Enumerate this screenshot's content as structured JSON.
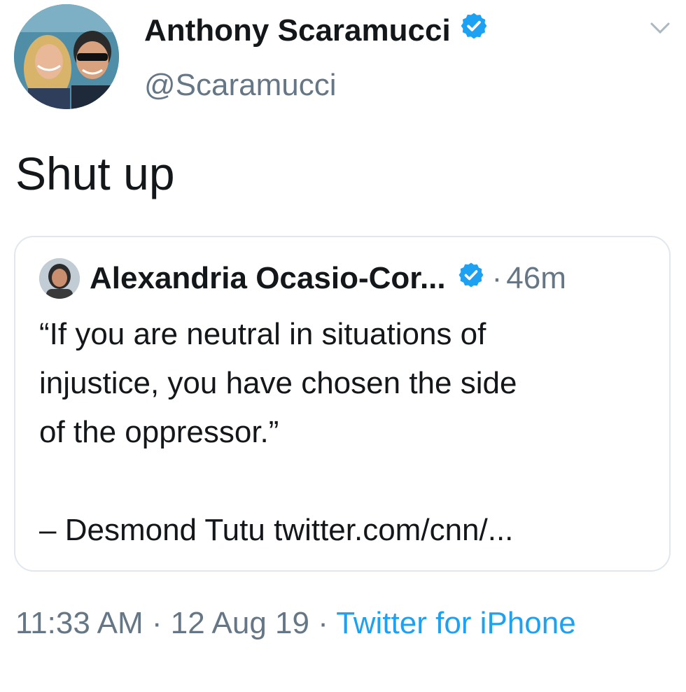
{
  "tweet": {
    "author_name": "Anthony Scaramucci",
    "handle": "@Scaramucci",
    "text": "Shut up",
    "time": "11:33 AM",
    "separator": "·",
    "date": "12 Aug 19",
    "source": "Twitter for iPhone"
  },
  "quoted_tweet": {
    "author_name": "Alexandria Ocasio-Cor...",
    "separator": "·",
    "time_ago": "46m",
    "text_lines": [
      "“If you are neutral in situations of",
      "injustice, you have chosen the side",
      "of the oppressor.”"
    ],
    "attribution": "– Desmond Tutu twitter.com/cnn/..."
  },
  "icons": {
    "verified": "verified-badge-icon",
    "menu": "chevron-down-icon"
  },
  "colors": {
    "verified": "#1da1f2",
    "link": "#1da1f2",
    "muted": "#657786",
    "text": "#14171a",
    "border": "#e1e8ed"
  }
}
